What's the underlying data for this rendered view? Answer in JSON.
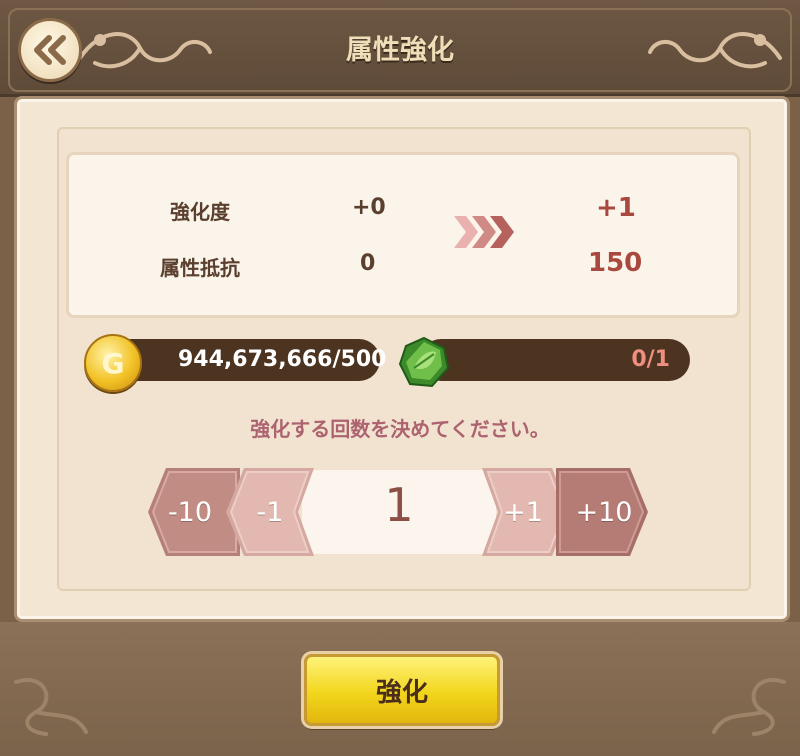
{
  "header": {
    "title": "属性強化",
    "back_icon": "double-chevron-left-icon"
  },
  "stats": {
    "rows": [
      {
        "label": "強化度",
        "current": "+0",
        "next": "+1"
      },
      {
        "label": "属性抵抗",
        "current": "0",
        "next": "150"
      }
    ],
    "arrow_icon": "triple-chevron-right-icon"
  },
  "resources": {
    "gold": {
      "icon": "gold-coin-icon",
      "coin_letter": "G",
      "value": "944,673,666/500"
    },
    "material": {
      "icon": "green-leaf-stone-icon",
      "value": "0/1"
    }
  },
  "prompt": "強化する回数を決めてください。",
  "stepper": {
    "minus10": "-10",
    "minus1": "-1",
    "value": "1",
    "plus1": "+1",
    "plus10": "+10"
  },
  "confirm_label": "強化",
  "colors": {
    "frame": "#7a6148",
    "panel": "#f3e6d2",
    "accent_red": "#a8483e",
    "confirm_yellow": "#f2d61c"
  }
}
